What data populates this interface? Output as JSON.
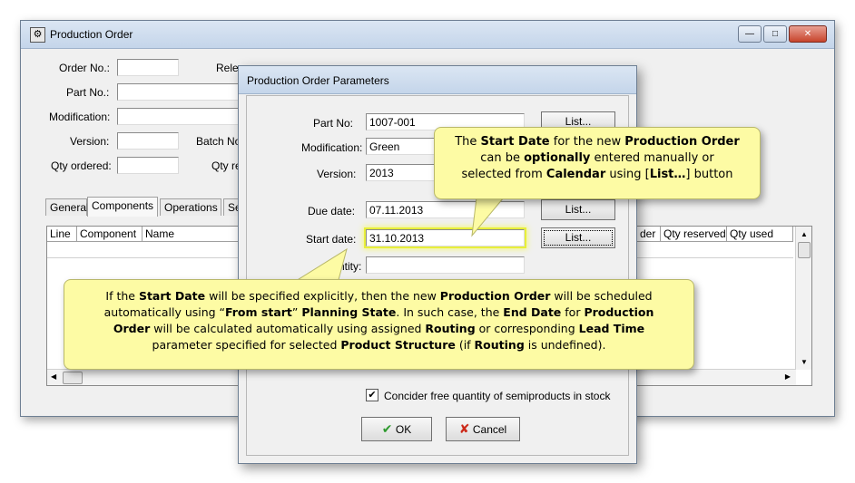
{
  "main_window": {
    "title": "Production Order",
    "buttons": {
      "minimize": "—",
      "maximize": "□",
      "close": "✕"
    },
    "labels": {
      "order_no": "Order No.:",
      "release": "Rele",
      "part_no": "Part No.:",
      "modification": "Modification:",
      "version": "Version:",
      "batch_no": "Batch No",
      "qty_ordered": "Qty ordered:",
      "qty_re": "Qty re"
    },
    "tabs": [
      "General",
      "Components",
      "Operations",
      "Se"
    ],
    "grid_headers": [
      "Line",
      "Component",
      "Name",
      "der",
      "Qty reserved",
      "Qty used"
    ]
  },
  "dialog": {
    "title": "Production Order Parameters",
    "labels": {
      "part_no": "Part No:",
      "modification": "Modification:",
      "version": "Version:",
      "due_date": "Due date:",
      "start_date": "Start date:",
      "quantity": "ntity:"
    },
    "values": {
      "part_no": "1007-001",
      "modification": "Green",
      "version": "2013",
      "due_date": "07.11.2013",
      "start_date": "31.10.2013",
      "quantity": ""
    },
    "list_button": "List...",
    "checkbox_label": "Concider free quantity of semiproducts in stock",
    "ok_label": "OK",
    "cancel_label": "Cancel"
  },
  "callout_top": {
    "l1a": "The ",
    "l1b": "Start Date",
    "l1c": " for the new ",
    "l1d": "Production Order",
    "l2a": "can be ",
    "l2b": "optionally",
    "l2c": " entered manually or",
    "l3a": "selected from ",
    "l3b": "Calendar",
    "l3c": " using [",
    "l3d": "List…",
    "l3e": "] button"
  },
  "callout_bottom": {
    "l1a": "If the ",
    "l1b": "Start Date",
    "l1c": " will be specified explicitly, then the new ",
    "l1d": "Production Order",
    "l1e": " will be scheduled",
    "l2a": "automatically using “",
    "l2b": "From start",
    "l2c": "” ",
    "l2d": "Planning State",
    "l2e": ". In such case, the ",
    "l2f": "End Date",
    "l2g": " for ",
    "l2h": "Production",
    "l3a": "Order",
    "l3b": " will be calculated automatically using assigned ",
    "l3c": "Routing",
    "l3d": " or corresponding ",
    "l3e": "Lead Time",
    "l4a": "parameter specified for selected ",
    "l4b": "Product Structure",
    "l4c": " (if ",
    "l4d": "Routing",
    "l4e": " is undefined)."
  },
  "colors": {
    "callout_bg": "#fdfba4",
    "highlight": "#e8ef3a",
    "cancel_x": "#cc2a1a",
    "ok_check": "#2e9a2e"
  }
}
